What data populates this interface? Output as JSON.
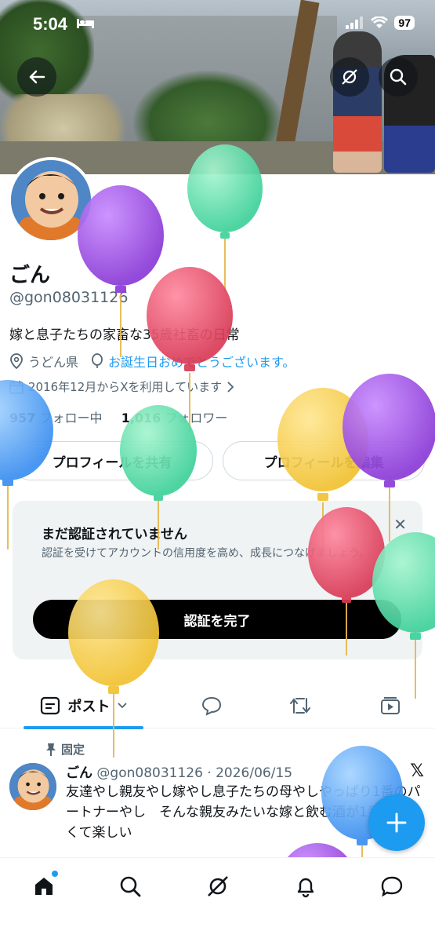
{
  "status_bar": {
    "time": "5:04",
    "battery": "97"
  },
  "profile": {
    "name": "ごん",
    "handle": "@gon08031126",
    "bio": "嫁と息子たちの家畜な35歳社畜の日常",
    "location": "うどん県",
    "birthday": "お誕生日おめでとうございます。",
    "joined": "2016年12月からXを利用しています",
    "following_count": "957",
    "following_label": "フォロー中",
    "followers_count": "1,016",
    "followers_label": "フォロワー"
  },
  "buttons": {
    "share": "プロフィールを共有",
    "edit": "プロフィールを編集"
  },
  "verification": {
    "title": "まだ認証されていません",
    "body": "認証を受けてアカウントの信用度を高め、成長につなげましょう。",
    "button": "認証を完了"
  },
  "tabs": {
    "posts": "ポスト"
  },
  "pinned_post": {
    "pinned_label": "固定",
    "author": "ごん",
    "handle_date": "@gon08031126 · 2026/06/15",
    "text": "友達やし親友やし嫁やし息子たちの母やしやっぱり1番のパートナーやし　そんな親友みたいな嫁と飲む酒が1番美味しくて楽しい"
  },
  "colors": {
    "accent": "#1d9bf0",
    "text": "#0f1419",
    "muted": "#536471"
  }
}
